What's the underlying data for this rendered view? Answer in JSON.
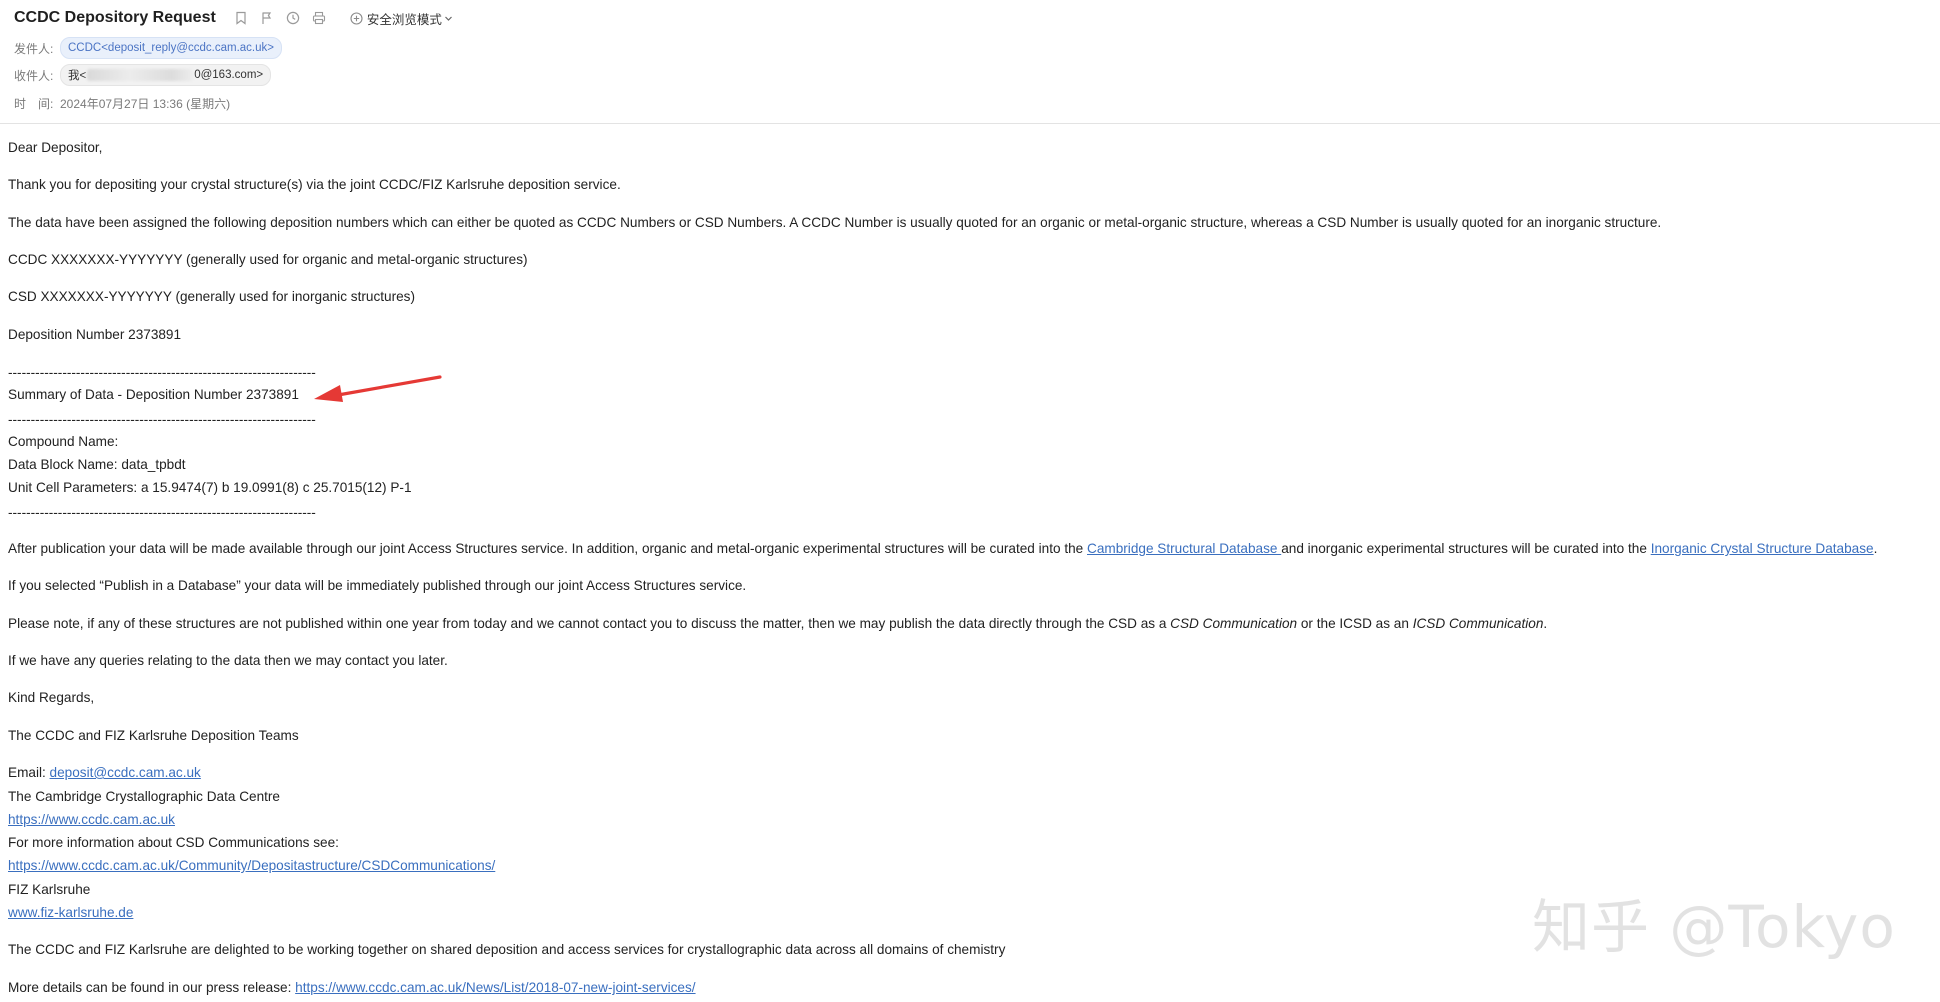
{
  "header": {
    "subject": "CCDC Depository Request",
    "safe_mode_label": "安全浏览模式",
    "from_label": "发件人:",
    "from_value": "CCDC<deposit_reply@ccdc.cam.ac.uk>",
    "to_label": "收件人:",
    "to_prefix": "我<",
    "to_suffix": "0@163.com>",
    "time_label": "时　间:",
    "time_value": "2024年07月27日 13:36 (星期六)",
    "icons": [
      "bookmark-icon",
      "flag-icon",
      "clock-icon",
      "print-icon"
    ]
  },
  "body": {
    "greeting": "Dear Depositor,",
    "thanks": "Thank you for depositing your crystal structure(s) via the joint CCDC/FIZ Karlsruhe deposition service.",
    "assigned": "The data have been assigned the following deposition numbers which can either be quoted as CCDC Numbers or CSD Numbers. A CCDC Number is usually quoted for an organic or metal-organic structure, whereas a CSD Number is usually quoted for an inorganic structure.",
    "ccdc_line": "CCDC XXXXXXX-YYYYYYY (generally used for organic and metal-organic structures)",
    "csd_line": "CSD XXXXXXX-YYYYYYY (generally used for inorganic structures)",
    "deposition_number": "Deposition Number 2373891",
    "divider": "--------------------------------------------------------------------",
    "summary_title": "Summary of Data - Deposition Number 2373891",
    "compound_name": "Compound Name:",
    "data_block": "Data Block Name: data_tpbdt",
    "unit_cell": "Unit Cell Parameters: a 15.9474(7) b 19.0991(8) c 25.7015(12) P-1",
    "after_pub_1": "After publication your data will be made available through our joint Access Structures service. In addition, organic and metal-organic experimental structures will be curated into the ",
    "csd_link": "Cambridge Structural Database ",
    "after_pub_2": "and inorganic experimental structures will be curated into the ",
    "icsd_link": "Inorganic Crystal Structure Database",
    "after_pub_3": ".",
    "publish_db": "If you selected “Publish in a Database” your data will be immediately published through our joint Access Structures service.",
    "note_1": "Please note, if any of these structures are not published within one year from today and we cannot contact you to discuss the matter, then we may publish the data directly through the CSD as a ",
    "note_csd_comm": "CSD Communication",
    "note_2": " or the ICSD as an ",
    "note_icsd_comm": "ICSD Communication",
    "note_3": ".",
    "queries": "If we have any queries relating to the data then we may contact you later.",
    "regards": "Kind Regards,",
    "teams": "The CCDC and FIZ Karlsruhe Deposition Teams",
    "email_label": "Email: ",
    "email_link": "deposit@ccdc.cam.ac.uk",
    "ccdc_full": "The Cambridge Crystallographic Data Centre",
    "ccdc_url": "https://www.ccdc.cam.ac.uk",
    "more_info": "For more information about CSD Communications see:",
    "csd_comm_url": "https://www.ccdc.cam.ac.uk/Community/Depositastructure/CSDCommunications/",
    "fiz": "FIZ Karlsruhe",
    "fiz_url": "www.fiz-karlsruhe.de",
    "delighted": "The CCDC and FIZ Karlsruhe are delighted to be working together on shared deposition and access services for crystallographic data across all domains of chemistry",
    "press_label": "More details can be found in our press release: ",
    "press_url": "https://www.ccdc.cam.ac.uk/News/List/2018-07-new-joint-services/"
  },
  "watermark": "知乎 @Tokyo",
  "colors": {
    "link": "#3a6fbf",
    "arrow": "#e53935",
    "sender_chip_bg": "#e9f0fb"
  }
}
